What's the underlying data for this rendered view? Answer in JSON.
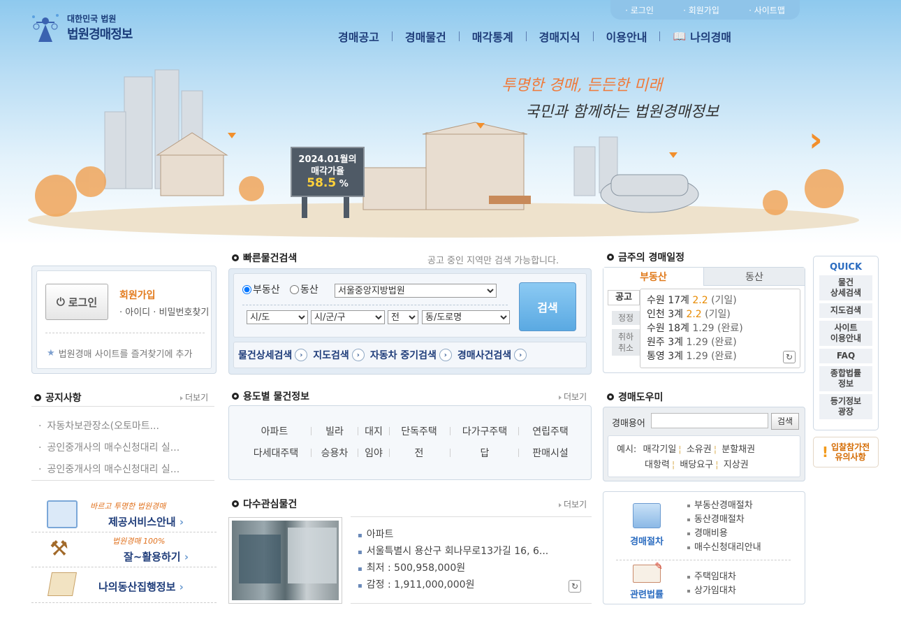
{
  "header": {
    "logo_top": "대한민국 법원",
    "logo_main": "법원경매정보",
    "util_links": [
      "로그인",
      "회원가입",
      "사이트맵"
    ],
    "gnb": [
      "경매공고",
      "경매물건",
      "매각통계",
      "경매지식",
      "이용안내",
      "나의경매"
    ]
  },
  "hero": {
    "slogan1": "투명한 경매, 든든한 미래",
    "slogan2": "국민과 함께하는 법원경매정보",
    "billboard_line1": "2024.01월의",
    "billboard_line2": "매각가율",
    "billboard_rate": "58.5",
    "billboard_unit": "%"
  },
  "login_box": {
    "login_btn": "로그인",
    "join": "회원가입",
    "find": "아이디 · 비밀번호찾기",
    "favorite": "법원경매 사이트를 즐겨찾기에 추가"
  },
  "quick_search": {
    "title": "빠른물건검색",
    "note": "공고 중인 지역만 검색 가능합니다.",
    "radio_real": "부동산",
    "radio_movable": "동산",
    "court": "서울중앙지방법원",
    "sido": "시/도",
    "sigungu": "시/군/구",
    "all": "전",
    "dong": "동/도로명",
    "search_btn": "검색",
    "links": [
      "물건상세검색",
      "지도검색",
      "자동차 중기검색",
      "경매사건검색"
    ]
  },
  "schedule": {
    "title": "금주의 경매일정",
    "tab_real": "부동산",
    "tab_movable": "동산",
    "side_labels": [
      "공고",
      "정정",
      "취하",
      "취소"
    ],
    "items": [
      {
        "court": "수원 17계",
        "date": "2.2",
        "status": "(기일)"
      },
      {
        "court": "인천 3계",
        "date": "2.2",
        "status": "(기일)"
      },
      {
        "court": "수원 18계",
        "date": "1.29",
        "status": "(완료)"
      },
      {
        "court": "원주 3계",
        "date": "1.29",
        "status": "(완료)"
      },
      {
        "court": "통영 3계",
        "date": "1.29",
        "status": "(완료)"
      }
    ]
  },
  "quick_menu": {
    "title": "QUICK",
    "items": [
      "물건\n상세검색",
      "지도검색",
      "사이트\n이용안내",
      "FAQ",
      "종합법률\n정보",
      "등기정보\n광장"
    ],
    "notice_line1": "입찰참가전",
    "notice_line2": "유의사항"
  },
  "notice": {
    "title": "공지사항",
    "more": "더보기",
    "items": [
      "자동차보관장소(오토마트...",
      "공인중개사의 매수신청대리 실...",
      "공인중개사의 매수신청대리 실..."
    ]
  },
  "usage": {
    "title": "용도별 물건정보",
    "more": "더보기",
    "row1": [
      "아파트",
      "빌라",
      "대지",
      "단독주택",
      "다가구주택",
      "연립주택"
    ],
    "row2": [
      "다세대주택",
      "승용차",
      "임야",
      "전",
      "답",
      "판매시설"
    ]
  },
  "helper": {
    "title": "경매도우미",
    "label": "경매용어",
    "search_btn": "검색",
    "example_label": "예시:",
    "keywords1": [
      "매각기일",
      "소유권",
      "분할채권"
    ],
    "keywords2": [
      "대항력",
      "배당요구",
      "지상권"
    ]
  },
  "banners": [
    {
      "small": "바르고 투명한 법원경매",
      "main": "제공서비스안내"
    },
    {
      "small": "법원경매 100%",
      "main": "잘~활용하기"
    },
    {
      "small": "",
      "main": "나의동산집행정보"
    }
  ],
  "hot": {
    "title": "다수관심물건",
    "more": "더보기",
    "items": [
      "아파트",
      "서울특별시 용산구 회나무로13가길 16, 6...",
      "최저 : 500,958,000원",
      "감정 : 1,911,000,000원"
    ]
  },
  "procedure": {
    "label1": "경매절차",
    "items1": [
      "부동산경매절차",
      "동산경매절차",
      "경매비용",
      "매수신청대리안내"
    ],
    "label2": "관련법률",
    "items2": [
      "주택임대차",
      "상가임대차"
    ]
  },
  "colors": {
    "accent": "#1f3d7a",
    "orange": "#f28f2c",
    "sky": "#8ec9ee"
  }
}
